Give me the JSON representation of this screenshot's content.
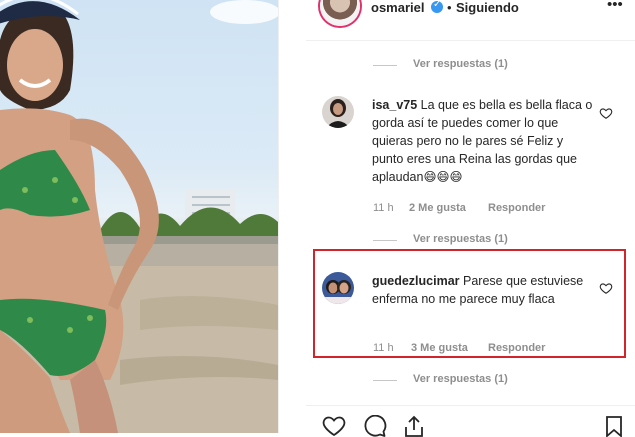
{
  "header": {
    "username": "osmariel",
    "separator": "•",
    "follow_status": "Siguiendo",
    "more_label": "•••"
  },
  "replies_label": "Ver respuestas (1)",
  "comments": [
    {
      "username": "isa_v75",
      "text": "La que es bella es bella flaca o gorda así te puedes comer lo que quieras pero no le pares sé Feliz y punto eres una Reina las gordas que aplaudan😄😄😄",
      "time": "11 h",
      "likes": "2 Me gusta",
      "reply": "Responder"
    },
    {
      "username": "guedezlucimar",
      "text": "Parese que estuviese enferma no me parece muy flaca",
      "time": "11 h",
      "likes": "3 Me gusta",
      "reply": "Responder"
    }
  ],
  "colors": {
    "highlight": "#d0262b",
    "verified": "#3897f0",
    "secondary_text": "#8e8e8e"
  },
  "icons": [
    "heart-icon",
    "comment-icon",
    "share-icon",
    "bookmark-icon",
    "verified-badge-icon"
  ]
}
